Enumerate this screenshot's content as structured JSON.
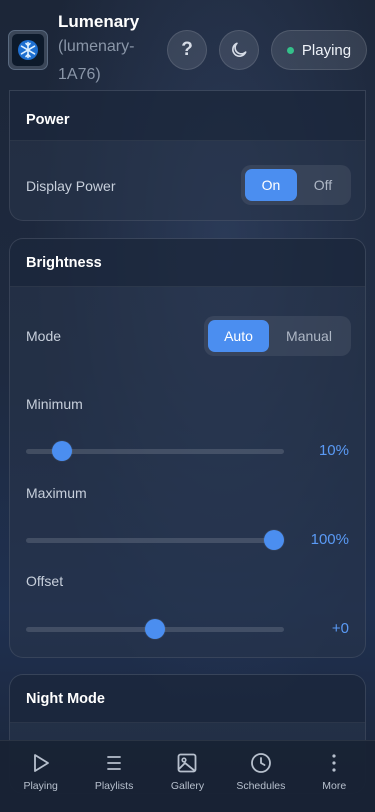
{
  "header": {
    "app_name": "Lumenary",
    "device_id": "(lumenary-1A76)",
    "status": "Playing",
    "status_color": "#34c08a",
    "logo_icon": "snowflake-icon",
    "help_icon": "question-icon",
    "theme_icon": "moon-icon"
  },
  "power": {
    "title": "Power",
    "display_power_label": "Display Power",
    "options": [
      "On",
      "Off"
    ],
    "selected": "On"
  },
  "brightness": {
    "title": "Brightness",
    "mode_label": "Mode",
    "mode_options": [
      "Auto",
      "Manual"
    ],
    "mode_selected": "Auto",
    "minimum": {
      "label": "Minimum",
      "value_text": "10%",
      "fraction": 0.14
    },
    "maximum": {
      "label": "Maximum",
      "value_text": "100%",
      "fraction": 0.96
    },
    "offset": {
      "label": "Offset",
      "value_text": "+0",
      "fraction": 0.5
    }
  },
  "night_mode": {
    "title": "Night Mode"
  },
  "nav": {
    "items": [
      {
        "label": "Playing",
        "icon": "play-icon"
      },
      {
        "label": "Playlists",
        "icon": "list-icon"
      },
      {
        "label": "Gallery",
        "icon": "image-icon"
      },
      {
        "label": "Schedules",
        "icon": "clock-icon"
      },
      {
        "label": "More",
        "icon": "more-vertical-icon"
      }
    ]
  },
  "colors": {
    "accent": "#4b8ef0",
    "value_text": "#5a9af5"
  }
}
